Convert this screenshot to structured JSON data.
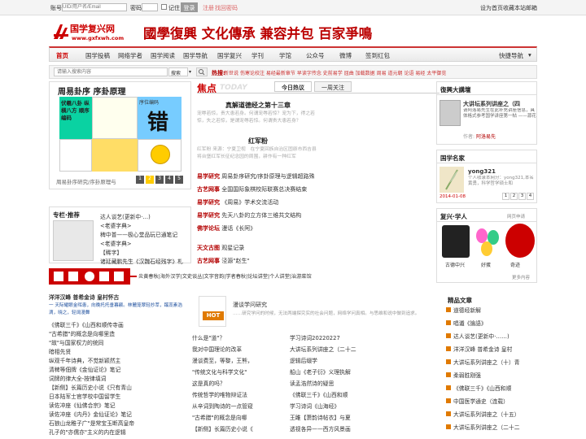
{
  "topbar": {
    "account_label": "账号",
    "account_placeholder": "UID/用户名/Email",
    "password_label": "密码",
    "remember_label": "记住",
    "login_button": "登录",
    "register": "注册",
    "forgot": "找回密码",
    "right_links": [
      "设为首页",
      "收藏本站",
      "邮箱"
    ]
  },
  "logo": {
    "name": "国学复兴网",
    "url": "www.gxfxwh.com"
  },
  "slogan": "國學復興 文化傳承 兼容并包 百家爭鳴",
  "nav": {
    "items": [
      "首页",
      "国学投稿",
      "网络学者",
      "国学阅读",
      "国学导航",
      "国学复兴",
      "学刊",
      "学馆",
      "公众号",
      "微博",
      "签到红包"
    ],
    "quick": "快捷导航"
  },
  "search": {
    "placeholder": "请输入搜索内容",
    "type": "搜索",
    "hot_label": "热搜:",
    "hot_items": [
      "新世说",
      "伤寒论校注",
      "易经最新章节",
      "早读字传念",
      "史前易学",
      "屈曲",
      "加载数据",
      "周易",
      "道元朝",
      "论语",
      "易经",
      "太平御览"
    ]
  },
  "carousel": {
    "title": "周易卦序 序卦原理",
    "cell_tag": "序位编码",
    "big_char": "错",
    "left_text": "伏羲八卦 纵横八方 顺序编码",
    "caption": "周易卦序研究/序卦原理与",
    "dots": [
      "1",
      "2",
      "3",
      "4",
      "5"
    ]
  },
  "recommend": {
    "title": "专栏·推荐",
    "items": [
      "达人谈艺(更新中·…)",
      "<老婆字典>",
      "稗中普——极心堂品玩已通笔记",
      "<老婆字典>",
      "【稀字】",
      "诸延藏鹏先生《汉魏石经残字》札"
    ]
  },
  "focus": {
    "title": "焦点",
    "subtitle": "TODAY",
    "tabs": [
      "今日热议",
      "一周关注"
    ],
    "headline": "真解道德经之第十三章",
    "summary": "宠辱若惊，贵大患若身。何谓宠辱若惊？宠为下，得之若惊，失之若惊，是谓宠辱若惊。何谓贵大患若身？",
    "headline2": "红军粉",
    "summary2": "红军粉 来源：宁夏卫视　在宁夏回族自治区固原市西吉县将台堡红军长征纪念园的周围，耕作有一种红军",
    "news": [
      {
        "cat": "易学研究",
        "text": "周易卦序研究/序卦原理与逻辑超路殊"
      },
      {
        "cat": "古艺网事",
        "text": "全国国际象棋校际联赛总决赛结束"
      },
      {
        "cat": "易学研究",
        "text": "《周易》学术交流活动"
      },
      {
        "cat": "易学研究",
        "text": "先天八卦的立方体三维共文结构"
      },
      {
        "cat": "佛学论坛",
        "text": "漫话《长阿》"
      }
    ],
    "news2": [
      {
        "cat": "天文古图",
        "text": "观星记录"
      },
      {
        "cat": "古艺网事",
        "text": "泾源\"赵生\""
      }
    ]
  },
  "lecture": {
    "title": "復興大講壇",
    "item_title": "大讲坛系列讲座之（四",
    "item_desc": "请阿洛易先生在此补充讲座信息，具体格式参考国学讲座第一帖 ——源花",
    "author_label": "作者:",
    "author": "阿洛易先"
  },
  "famous": {
    "title": "国学名家",
    "name": "yong321",
    "desc": "个人收录本网分：yong321,本名黄勇，科学哲学硕士和",
    "date": "2014-01-08",
    "pages": [
      "1",
      "2",
      "3",
      "4"
    ]
  },
  "fuxing": {
    "title": "复兴·学人",
    "more": "网页申请",
    "people": [
      "古德中兴",
      "好蛋",
      "奇迹"
    ],
    "more2": "更多内容"
  },
  "banner": {
    "links": [
      "炎黄春秋",
      "海外汉学",
      "文史谈丛",
      "文字音韵",
      "学者春秋",
      "论坛讲堂",
      "个人讲堂",
      "治游菜馆"
    ]
  },
  "left_bottom": {
    "title": "洋洋汉峰 普希金诗 皇村怀古",
    "intro": "一 天际耀眼金晖患，向晚托托垂暮颛。林麓笼翠轻抄萃，蹊蕊素浩滴，晓之，轻阔漫舞",
    "items": [
      "《佛联三千》《山西和顺传寺画",
      "\"古希腊\"的概念是向哪里造",
      "\"故\"与国家权力的统同",
      "暗相先贤",
      "纵观千年诗典，不觉新颖然主",
      "清稗等佃牌《金仙证论》笔记",
      "词牌的律大全-按律填词",
      "【新侧】长篇历史小说《只有青山",
      "日本陆军士官学校中国留学生",
      "读佐冲座《仙佛合宗》笔记",
      "读佐冲座《内丹》金仙证论》笔记",
      "石狼山龙稚子广\"是常宝玉断高皇帝",
      "孔子的\"亦儒亦\"主义的内在逻辑"
    ]
  },
  "mid_bottom": {
    "hot": "HOT",
    "feature_title": "漫谈学问研究",
    "feature_desc": "……研究学问的时候，无法两端探究实的社会问题，网络学问真相。与思维和说中做到追求。",
    "col1": [
      "什么是\"道\"？",
      "我对中国理论的改革",
      "漫谈费至，等黎，王熊，",
      "\"传统文化与科学文化\"",
      "这是真的吗？",
      "传统哲学的唯物辩证法",
      "从辛词到陶诗的一点管窥",
      "\"古希腊\"的概念是向哪",
      "【新侧】长篇历史小说《"
    ],
    "col2": [
      "学习诗词20220227",
      "大讲坛系列讲座之（二十二",
      "逻辑后缀学",
      "船山《老子衍》义理执解",
      "读孟浩然诗的疑思",
      "《佛联三千》《山西和顺",
      "学习诗词《山海经》",
      "王雎【萧韵诗帖衣】与夏",
      "透视各异——西方风景画"
    ]
  },
  "right_bottom": {
    "title": "精品文章",
    "items": [
      "道德经新解",
      "唱谶《論語》",
      "达人谈艺(更新中·……)",
      "洋洋汉峰 普希金诗 皇村",
      "大讲坛系列讲座之（十）青",
      "柔弱胜刚强",
      "《佛联三千》《山西和顺",
      "中国医学通史（连载）",
      "大讲坛系列讲座之（十五）",
      "大讲坛系列讲座之（二十二"
    ]
  },
  "colors": {
    "brand_red": "#c00000",
    "link_blue": "#1a4c9c",
    "orange": "#e07a00"
  }
}
